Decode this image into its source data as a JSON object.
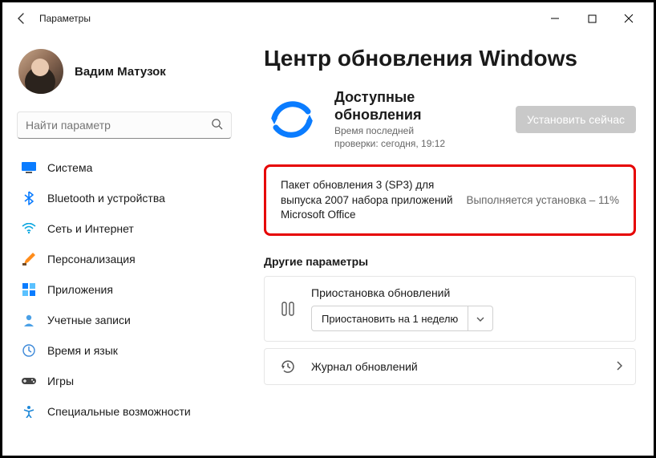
{
  "titlebar": {
    "label": "Параметры"
  },
  "user": {
    "name": "Вадим Матузок"
  },
  "search": {
    "placeholder": "Найти параметр"
  },
  "nav": {
    "system": "Система",
    "bluetooth": "Bluetooth и устройства",
    "network": "Сеть и Интернет",
    "personalization": "Персонализация",
    "apps": "Приложения",
    "accounts": "Учетные записи",
    "timelang": "Время и язык",
    "gaming": "Игры",
    "accessibility": "Специальные возможности"
  },
  "page": {
    "title": "Центр обновления Windows"
  },
  "updates": {
    "title": "Доступные обновления",
    "subtitle": "Время последней\nпроверки: сегодня, 19:12",
    "install_btn": "Установить сейчас"
  },
  "pending_update": {
    "name": "Пакет обновления 3 (SP3) для выпуска 2007 набора приложений Microsoft Office",
    "status": "Выполняется установка – 11%"
  },
  "other": {
    "section": "Другие параметры",
    "pause_title": "Приостановка обновлений",
    "pause_option": "Приостановить на 1 неделю",
    "history_title": "Журнал обновлений"
  }
}
